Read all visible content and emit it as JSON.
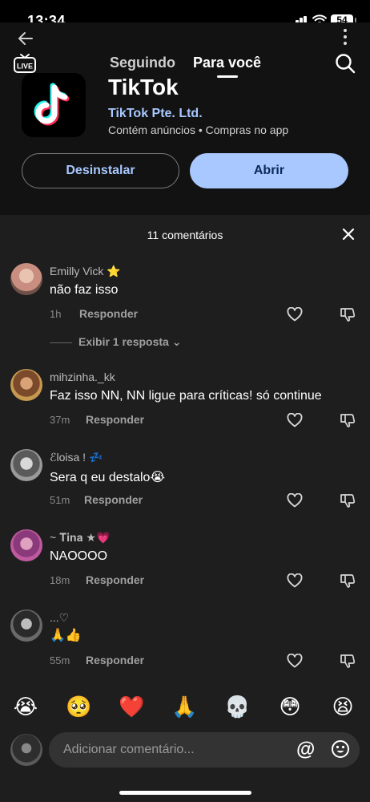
{
  "status_bar": {
    "time": "13:34",
    "battery": "54"
  },
  "feed_tabs": {
    "following": "Seguindo",
    "for_you": "Para você",
    "live_label": "LIVE"
  },
  "app": {
    "name": "TikTok",
    "developer": "TikTok Pte. Ltd.",
    "meta": "Contém anúncios  •  Compras no app",
    "uninstall_label": "Desinstalar",
    "open_label": "Abrir"
  },
  "comments_sheet": {
    "title": "11 comentários",
    "reply_label": "Responder",
    "view_replies": "Exibir 1 resposta ⌄",
    "comments": [
      {
        "user": "Emilly Vick ⭐",
        "text": "não faz isso",
        "time": "1h"
      },
      {
        "user": "mihzinha._kk",
        "text": "Faz isso NN, NN ligue para críticas! só continue",
        "time": "37m"
      },
      {
        "user": "ℰloisa ! 💤",
        "text": "Sera q eu destalo😭",
        "time": "51m"
      },
      {
        "user": "~ 𝐓𝐢𝐧𝐚 ★💗",
        "text": "NAOOOO",
        "time": "18m"
      },
      {
        "user": "...♡",
        "text": "🙏👍",
        "time": "55m"
      }
    ],
    "quick_emojis": [
      "😭",
      "🥺",
      "❤️",
      "🙏",
      "💀",
      "😳",
      "😫"
    ],
    "input_placeholder": "Adicionar comentário...",
    "at_symbol": "@"
  },
  "colors": {
    "accent": "#a8c8ff",
    "sheet_bg": "#1e1e1e",
    "header_bg": "#121212"
  }
}
